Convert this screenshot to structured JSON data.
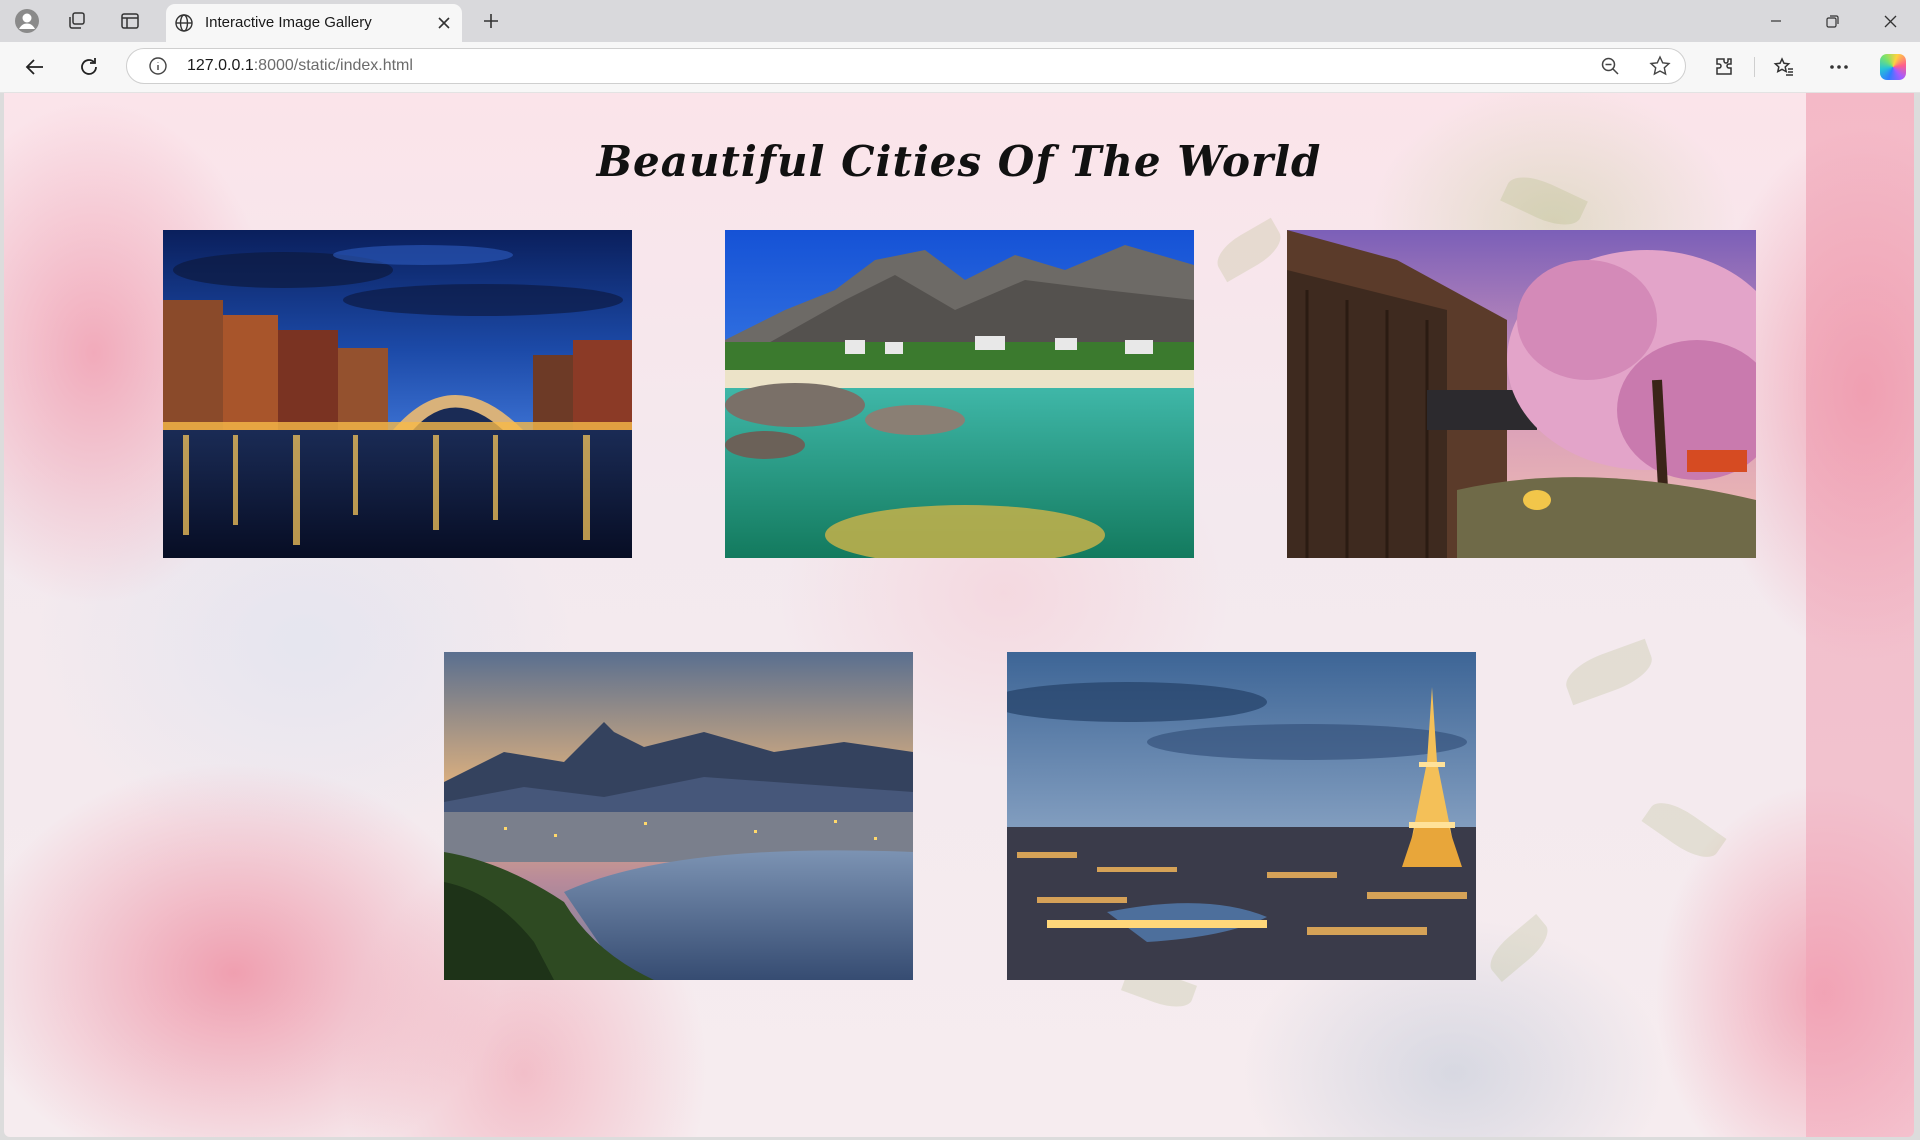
{
  "browser": {
    "tab_title": "Interactive Image Gallery",
    "url_host": "127.0.0.1",
    "url_path": ":8000/static/index.html"
  },
  "page": {
    "title": "Beautiful Cities Of The World"
  },
  "gallery": {
    "images": [
      {
        "scene": "canal-bridge-night"
      },
      {
        "scene": "mountain-coast-lagoon"
      },
      {
        "scene": "cherry-blossom-canal"
      },
      {
        "scene": "bay-city-dusk"
      },
      {
        "scene": "eiffel-tower-river-dusk"
      }
    ]
  }
}
